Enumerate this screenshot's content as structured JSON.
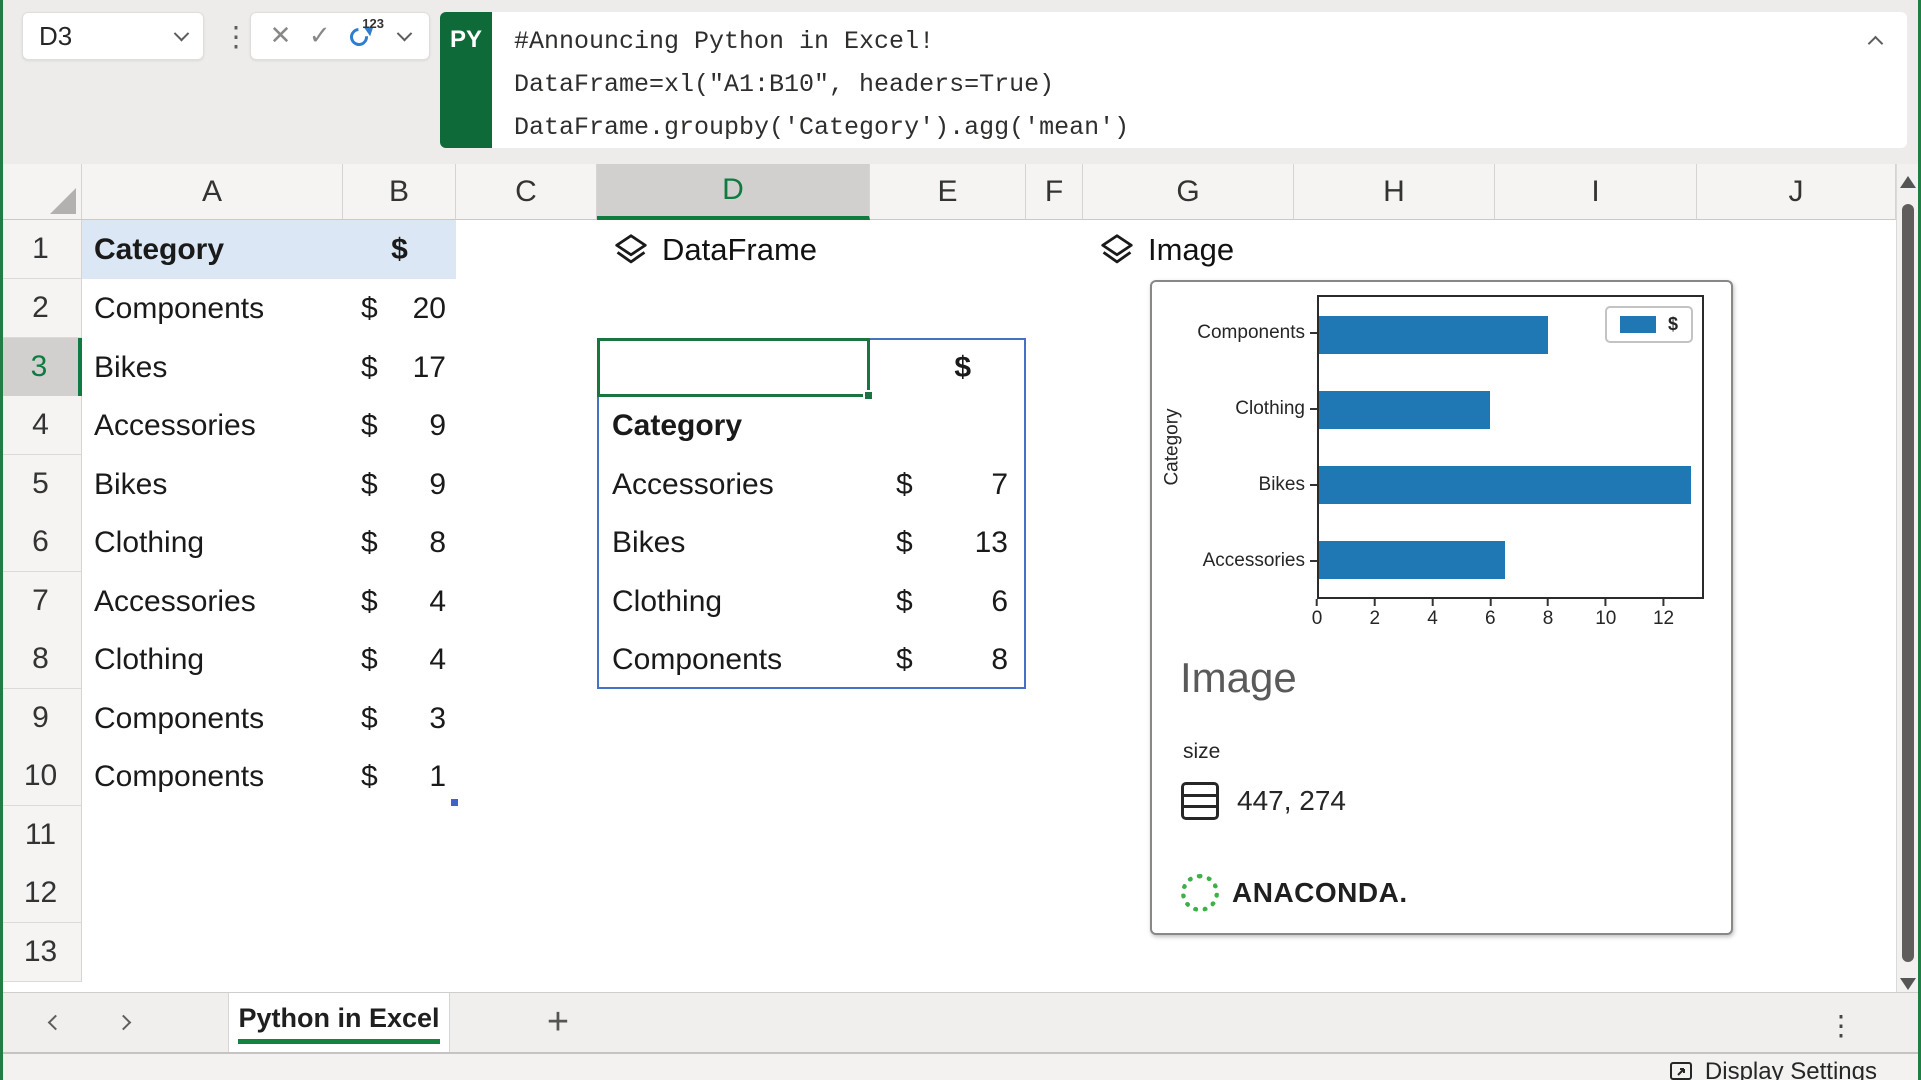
{
  "formula_bar": {
    "cell_reference": "D3",
    "language_badge": "PY",
    "code_lines": [
      "#Announcing Python in Excel!",
      "DataFrame=xl(\"A1:B10\", headers=True)",
      "DataFrame.groupby('Category').agg('mean')"
    ]
  },
  "column_headers": [
    "A",
    "B",
    "C",
    "D",
    "E",
    "F",
    "G",
    "H",
    "I",
    "J"
  ],
  "row_headers": [
    "1",
    "2",
    "3",
    "4",
    "5",
    "6",
    "7",
    "8",
    "9",
    "10",
    "11",
    "12",
    "13"
  ],
  "selection": {
    "active_cell": "D3",
    "active_column": "D",
    "active_row": "3"
  },
  "worksheet": {
    "table": {
      "header": {
        "category": "Category",
        "amount": "$"
      },
      "rows": [
        {
          "category": "Components",
          "currency": "$",
          "amount": "20"
        },
        {
          "category": "Bikes",
          "currency": "$",
          "amount": "17"
        },
        {
          "category": "Accessories",
          "currency": "$",
          "amount": "9"
        },
        {
          "category": "Bikes",
          "currency": "$",
          "amount": "9"
        },
        {
          "category": "Clothing",
          "currency": "$",
          "amount": "8"
        },
        {
          "category": "Accessories",
          "currency": "$",
          "amount": "4"
        },
        {
          "category": "Clothing",
          "currency": "$",
          "amount": "4"
        },
        {
          "category": "Components",
          "currency": "$",
          "amount": "3"
        },
        {
          "category": "Components",
          "currency": "$",
          "amount": "1"
        }
      ]
    },
    "dataframe_cell": {
      "type_label": "DataFrame",
      "spill": {
        "value_header": "$",
        "index_header": "Category",
        "rows": [
          {
            "category": "Accessories",
            "currency": "$",
            "amount": "7"
          },
          {
            "category": "Bikes",
            "currency": "$",
            "amount": "13"
          },
          {
            "category": "Clothing",
            "currency": "$",
            "amount": "6"
          },
          {
            "category": "Components",
            "currency": "$",
            "amount": "8"
          }
        ]
      }
    },
    "image_cell": {
      "type_label": "Image",
      "card": {
        "title": "Image",
        "size_label": "size",
        "size_value": "447, 274",
        "brand": "ANACONDA."
      }
    }
  },
  "chart_data": {
    "type": "bar",
    "orientation": "horizontal",
    "categories": [
      "Components",
      "Clothing",
      "Bikes",
      "Accessories"
    ],
    "series": [
      {
        "name": "$",
        "values": [
          8,
          6,
          13,
          6.5
        ]
      }
    ],
    "title": "",
    "xlabel": "",
    "ylabel": "Category",
    "xlim": [
      0,
      13.4
    ],
    "xticks": [
      0,
      2,
      4,
      6,
      8,
      10,
      12
    ],
    "legend": {
      "position": "upper right",
      "entries": [
        "$"
      ]
    },
    "grid": false,
    "bar_color": "#1f77b4"
  },
  "sheet_tabs": {
    "active_tab": "Python in Excel",
    "add_tab_label": "+"
  },
  "status_bar": {
    "display_settings_label": "Display Settings"
  },
  "colors": {
    "accent_green": "#107c41",
    "spill_blue": "#4472c4",
    "bar_blue": "#1f77b4",
    "reference_fill_blue": "#dbe7f4"
  }
}
